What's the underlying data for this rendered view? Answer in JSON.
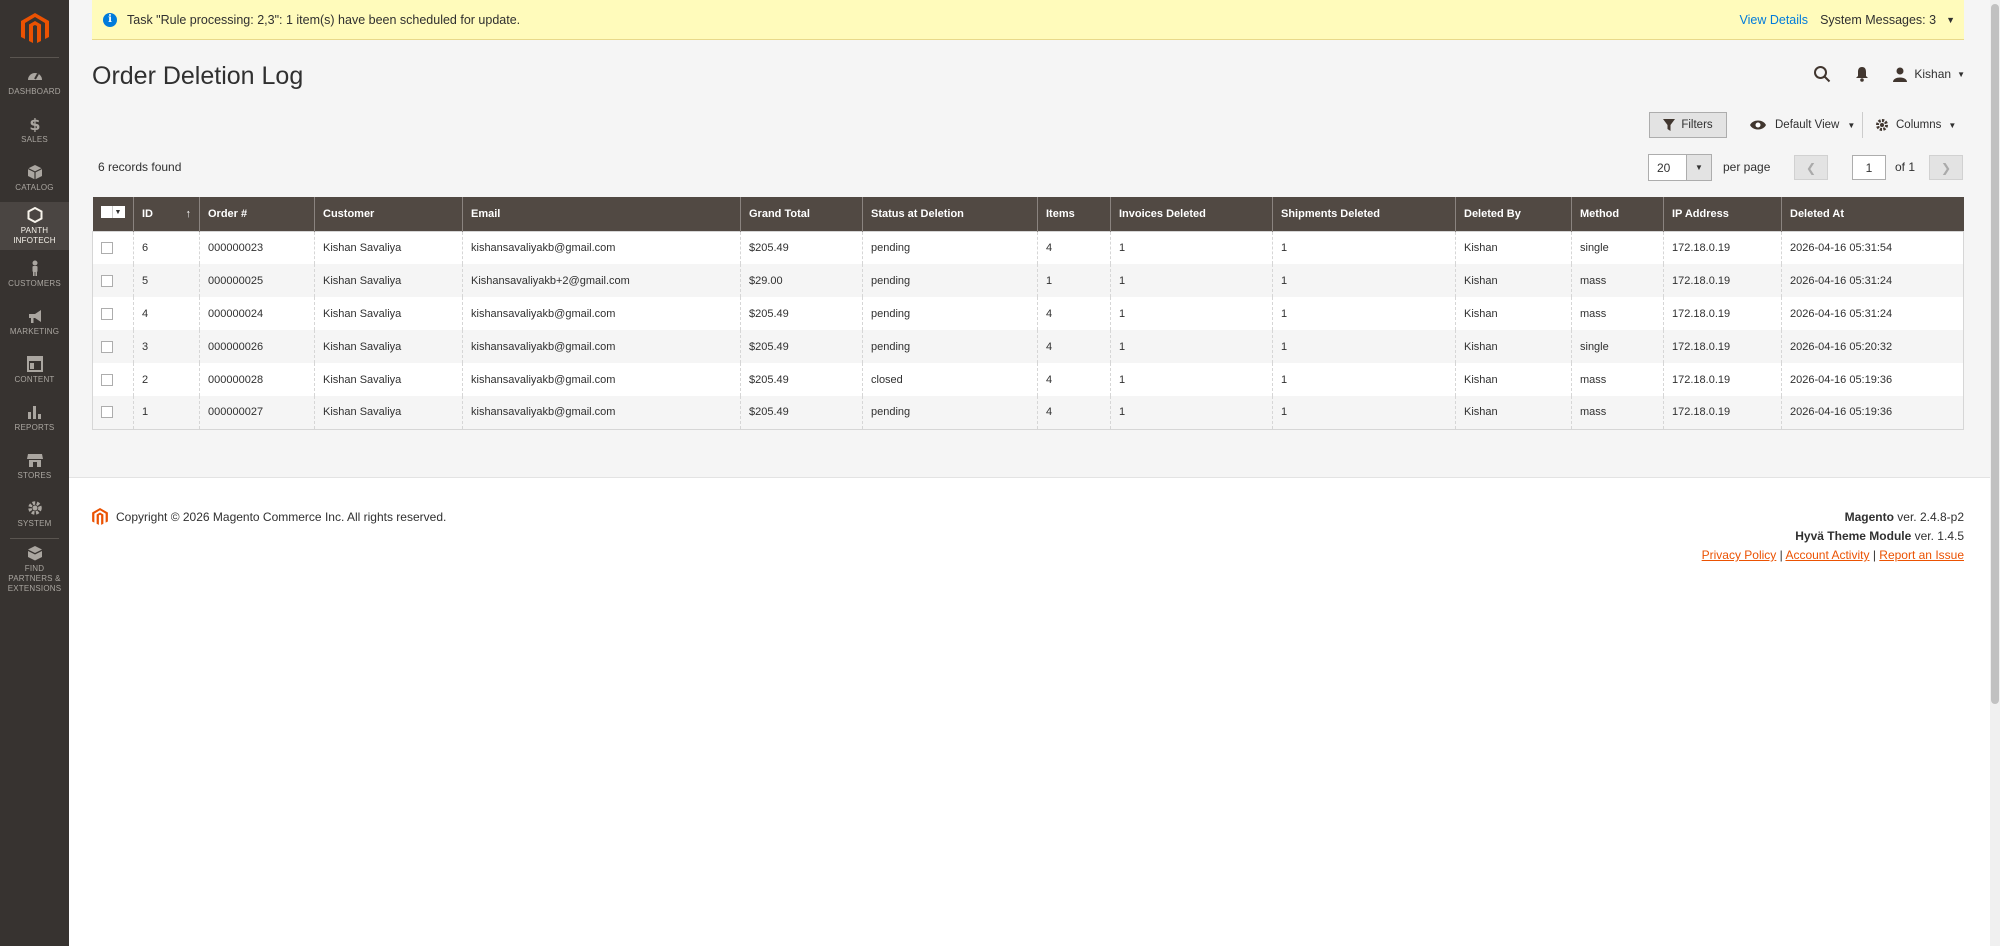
{
  "sidebar": {
    "items": [
      {
        "label": "Dashboard",
        "icon": "dashboard-icon"
      },
      {
        "label": "Sales",
        "icon": "dollar-icon"
      },
      {
        "label": "Catalog",
        "icon": "box-icon"
      },
      {
        "label": "Panth Infotech",
        "icon": "hexagon-icon"
      },
      {
        "label": "Customers",
        "icon": "person-icon"
      },
      {
        "label": "Marketing",
        "icon": "megaphone-icon"
      },
      {
        "label": "Content",
        "icon": "layout-icon"
      },
      {
        "label": "Reports",
        "icon": "bar-chart-icon"
      },
      {
        "label": "Stores",
        "icon": "store-icon"
      },
      {
        "label": "System",
        "icon": "gear-icon"
      },
      {
        "label": "Find Partners & Extensions",
        "icon": "blocks-icon"
      }
    ]
  },
  "message": {
    "text": "Task \"Rule processing: 2,3\": 1 item(s) have been scheduled for update.",
    "view_details": "View Details",
    "system_messages": "System Messages: 3"
  },
  "page": {
    "title": "Order Deletion Log",
    "user": "Kishan"
  },
  "toolbar": {
    "filters": "Filters",
    "default_view": "Default View",
    "columns": "Columns",
    "records_found": "6 records found",
    "per_page_value": "20",
    "per_page_label": "per page",
    "page_value": "1",
    "page_of": "of 1"
  },
  "table": {
    "headers": [
      "ID",
      "Order #",
      "Customer",
      "Email",
      "Grand Total",
      "Status at Deletion",
      "Items",
      "Invoices Deleted",
      "Shipments Deleted",
      "Deleted By",
      "Method",
      "IP Address",
      "Deleted At"
    ],
    "rows": [
      [
        "6",
        "000000023",
        "Kishan Savaliya",
        "kishansavaliyakb@gmail.com",
        "$205.49",
        "pending",
        "4",
        "1",
        "1",
        "Kishan",
        "single",
        "172.18.0.19",
        "2026-04-16 05:31:54"
      ],
      [
        "5",
        "000000025",
        "Kishan Savaliya",
        "Kishansavaliyakb+2@gmail.com",
        "$29.00",
        "pending",
        "1",
        "1",
        "1",
        "Kishan",
        "mass",
        "172.18.0.19",
        "2026-04-16 05:31:24"
      ],
      [
        "4",
        "000000024",
        "Kishan Savaliya",
        "kishansavaliyakb@gmail.com",
        "$205.49",
        "pending",
        "4",
        "1",
        "1",
        "Kishan",
        "mass",
        "172.18.0.19",
        "2026-04-16 05:31:24"
      ],
      [
        "3",
        "000000026",
        "Kishan Savaliya",
        "kishansavaliyakb@gmail.com",
        "$205.49",
        "pending",
        "4",
        "1",
        "1",
        "Kishan",
        "single",
        "172.18.0.19",
        "2026-04-16 05:20:32"
      ],
      [
        "2",
        "000000028",
        "Kishan Savaliya",
        "kishansavaliyakb@gmail.com",
        "$205.49",
        "closed",
        "4",
        "1",
        "1",
        "Kishan",
        "mass",
        "172.18.0.19",
        "2026-04-16 05:19:36"
      ],
      [
        "1",
        "000000027",
        "Kishan Savaliya",
        "kishansavaliyakb@gmail.com",
        "$205.49",
        "pending",
        "4",
        "1",
        "1",
        "Kishan",
        "mass",
        "172.18.0.19",
        "2026-04-16 05:19:36"
      ]
    ]
  },
  "footer": {
    "copyright": "Copyright © 2026 Magento Commerce Inc. All rights reserved.",
    "magento_name": "Magento",
    "magento_ver": " ver. 2.4.8-p2",
    "hyva_name": "Hyvä Theme Module",
    "hyva_ver": " ver. 1.4.5",
    "privacy": "Privacy Policy",
    "activity": "Account Activity",
    "report": "Report an Issue",
    "sep": " | "
  },
  "colors": {
    "sidebar_bg": "#373330",
    "header_row": "#514943",
    "accent": "#eb5202",
    "link": "#007bdb",
    "message_bg": "#fffbbb"
  }
}
